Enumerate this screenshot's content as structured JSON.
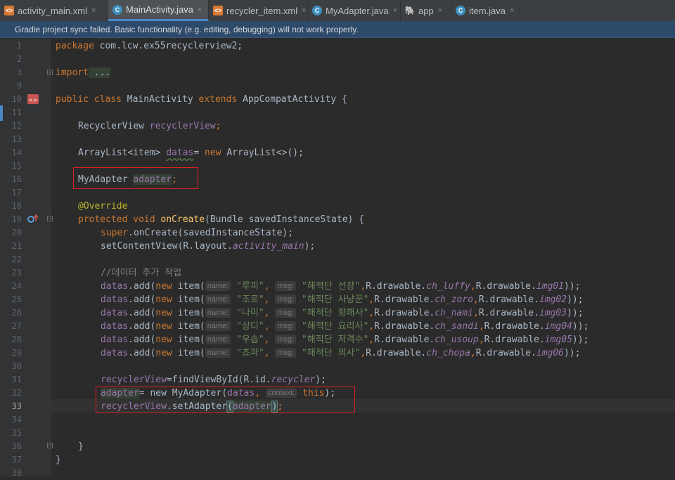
{
  "tabs": [
    {
      "label": "activity_main.xml",
      "type": "xml",
      "close": "×"
    },
    {
      "label": "MainActivity.java",
      "type": "java",
      "active": true,
      "close": "×"
    },
    {
      "label": "recycler_item.xml",
      "type": "xml",
      "close": "×"
    },
    {
      "label": "MyAdapter.java",
      "type": "java",
      "close": "×"
    },
    {
      "label": "app",
      "type": "app",
      "close": "×"
    },
    {
      "label": "item.java",
      "type": "java",
      "close": "×"
    }
  ],
  "banner": {
    "message": "Gradle project sync failed. Basic functionality (e.g. editing, debugging) will not work properly."
  },
  "gutter": {
    "line_numbers": [
      "1",
      "2",
      "3",
      "9",
      "10",
      "11",
      "12",
      "13",
      "14",
      "15",
      "16",
      "17",
      "18",
      "19",
      "20",
      "21",
      "22",
      "23",
      "24",
      "25",
      "26",
      "27",
      "28",
      "29",
      "30",
      "31",
      "32",
      "33",
      "34",
      "35",
      "36",
      "37",
      "38"
    ],
    "current_line": "33"
  },
  "code": {
    "package_kw": "package",
    "package_name": " com.lcw.ex55recyclerview2;",
    "import_kw": "import",
    "import_fold": " ...",
    "class_public": "public class ",
    "class_name": "MainActivity ",
    "class_extends": "extends ",
    "class_super": "AppCompatActivity {",
    "rv_type": "RecyclerView ",
    "rv_field": "recyclerView",
    "rv_semi": ";",
    "list_type": "ArrayList<item> ",
    "list_field": "datas",
    "list_eq": "= ",
    "list_new": "new ",
    "list_ctor": "ArrayList<>();",
    "adapter_type": "MyAdapter ",
    "adapter_field": "adapter",
    "adapter_semi": ";",
    "override": "@Override",
    "oncreate_mod": "protected void ",
    "oncreate_name": "onCreate",
    "oncreate_params": "(Bundle savedInstanceState) {",
    "super_kw": "super",
    "super_call": ".onCreate(savedInstanceState);",
    "setcontent": "setContentView(R.layout.",
    "setcontent_static": "activity_main",
    "setcontent_end": ");",
    "comment": "//데이터 추가 작업",
    "datas_call": ".add(",
    "new_kw": "new ",
    "item_open": "item(",
    "hint_name": "name:",
    "hint_msg": "msg:",
    "rdrawable": "R.drawable.",
    "rows": [
      {
        "name": "\"루피\"",
        "msg": "\"해적단 선장\"",
        "img": "ch_luffy",
        "num": "img01"
      },
      {
        "name": "\"조로\"",
        "msg": "\"해적단 사냥꾼\"",
        "img": "ch_zoro",
        "num": "img02"
      },
      {
        "name": "\"나미\"",
        "msg": "\"해적단 항해사\"",
        "img": "ch_nami",
        "num": "img03"
      },
      {
        "name": "\"상디\"",
        "msg": "\"해적단 요리사\"",
        "img": "ch_sandi",
        "num": "img04"
      },
      {
        "name": "\"우솝\"",
        "msg": "\"해적단 저격수\"",
        "img": "ch_usoup",
        "num": "img05"
      },
      {
        "name": "\"쵸파\"",
        "msg": "\"해적단 의사\"",
        "img": "ch_chopa",
        "num": "img06"
      }
    ],
    "find_field": "recyclerView",
    "find_call": "=findViewById(R.id.",
    "find_static": "recycler",
    "find_end": ");",
    "adapter_assign": "adapter",
    "adapter_new": "= new ",
    "adapter_ctor": "MyAdapter(",
    "adapter_arg": "datas",
    "adapter_comma": ", ",
    "hint_context": "context:",
    "this_kw": "this",
    "adapter_ctor_end": ");",
    "set_field": "recyclerView",
    "set_call": ".setAdapter",
    "set_open": "(",
    "set_arg": "adapter",
    "set_close": ")",
    "set_semi": ";",
    "close_method": "}",
    "close_class": "}"
  },
  "colors": {
    "keyword": "#cc7832",
    "field": "#9876aa",
    "string": "#6a8759",
    "annotation": "#bbb529",
    "method": "#ffc66d",
    "highlight_box": "#e02020"
  }
}
